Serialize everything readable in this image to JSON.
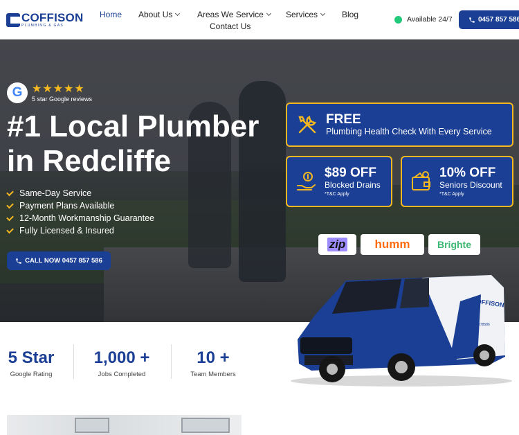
{
  "header": {
    "logo_name": "COFFISON",
    "logo_sub": "PLUMBING & GAS",
    "nav": [
      {
        "label": "Home",
        "active": true
      },
      {
        "label": "About Us"
      },
      {
        "label": "Areas We Service"
      },
      {
        "label": "Services"
      },
      {
        "label": "Blog"
      },
      {
        "label": "Contact Us"
      }
    ],
    "availability": "Available 24/7",
    "call_label": "0457 857 586"
  },
  "hero": {
    "google_letter": "G",
    "stars": "★★★★★",
    "rating_label": "5 star Google reviews",
    "title_line1": "#1 Local Plumber",
    "title_line2": "in Redcliffe",
    "features": [
      "Same-Day Service",
      "Payment Plans Available",
      "12-Month Workmanship Guarantee",
      "Fully Licensed & Insured"
    ],
    "call_button": "CALL NOW 0457 857 586"
  },
  "offers": [
    {
      "big": "FREE",
      "sub": "Plumbing Health Check With Every Service",
      "tc": "",
      "icon": "tools-icon"
    },
    {
      "big": "$89 OFF",
      "sub": "Blocked Drains",
      "tc": "*T&C Apply",
      "icon": "money-hand-icon"
    },
    {
      "big": "10% OFF",
      "sub": "Seniors Discount",
      "tc": "*T&C Apply",
      "icon": "wallet-icon"
    }
  ],
  "finance_logos": [
    "zip",
    "humm",
    "Brighte"
  ],
  "van": {
    "brand": "COFFISON",
    "phone": "1300078586"
  },
  "stats": [
    {
      "value": "5 Star",
      "label": "Google Rating"
    },
    {
      "value": "1,000 +",
      "label": "Jobs Completed"
    },
    {
      "value": "10 +",
      "label": "Team Members"
    }
  ],
  "colors": {
    "brand_blue": "#1b3f94",
    "accent_gold": "#f5b820",
    "status_green": "#22c97a"
  }
}
